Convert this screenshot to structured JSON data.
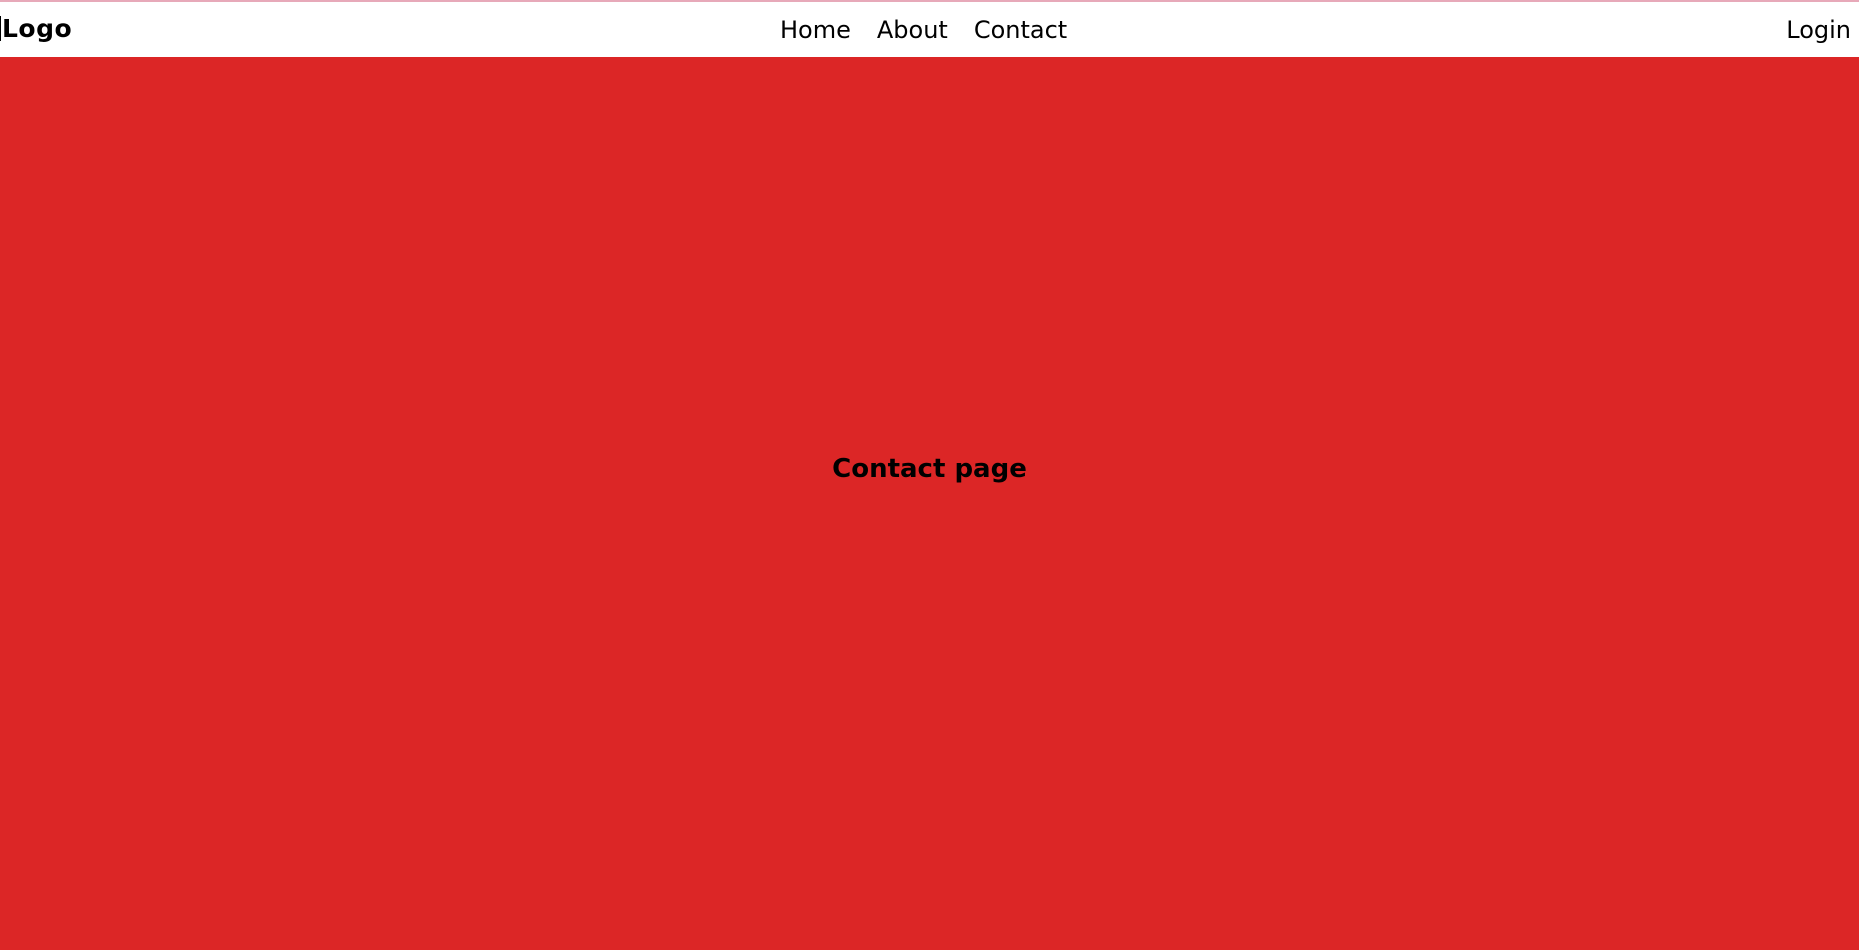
{
  "nav": {
    "logo": "Logo",
    "links": [
      "Home",
      "About",
      "Contact"
    ],
    "login": "Login"
  },
  "main": {
    "heading": "Contact page"
  },
  "colors": {
    "hero_background": "#dc2626",
    "top_accent": "#e7a9b9",
    "text": "#000000"
  }
}
